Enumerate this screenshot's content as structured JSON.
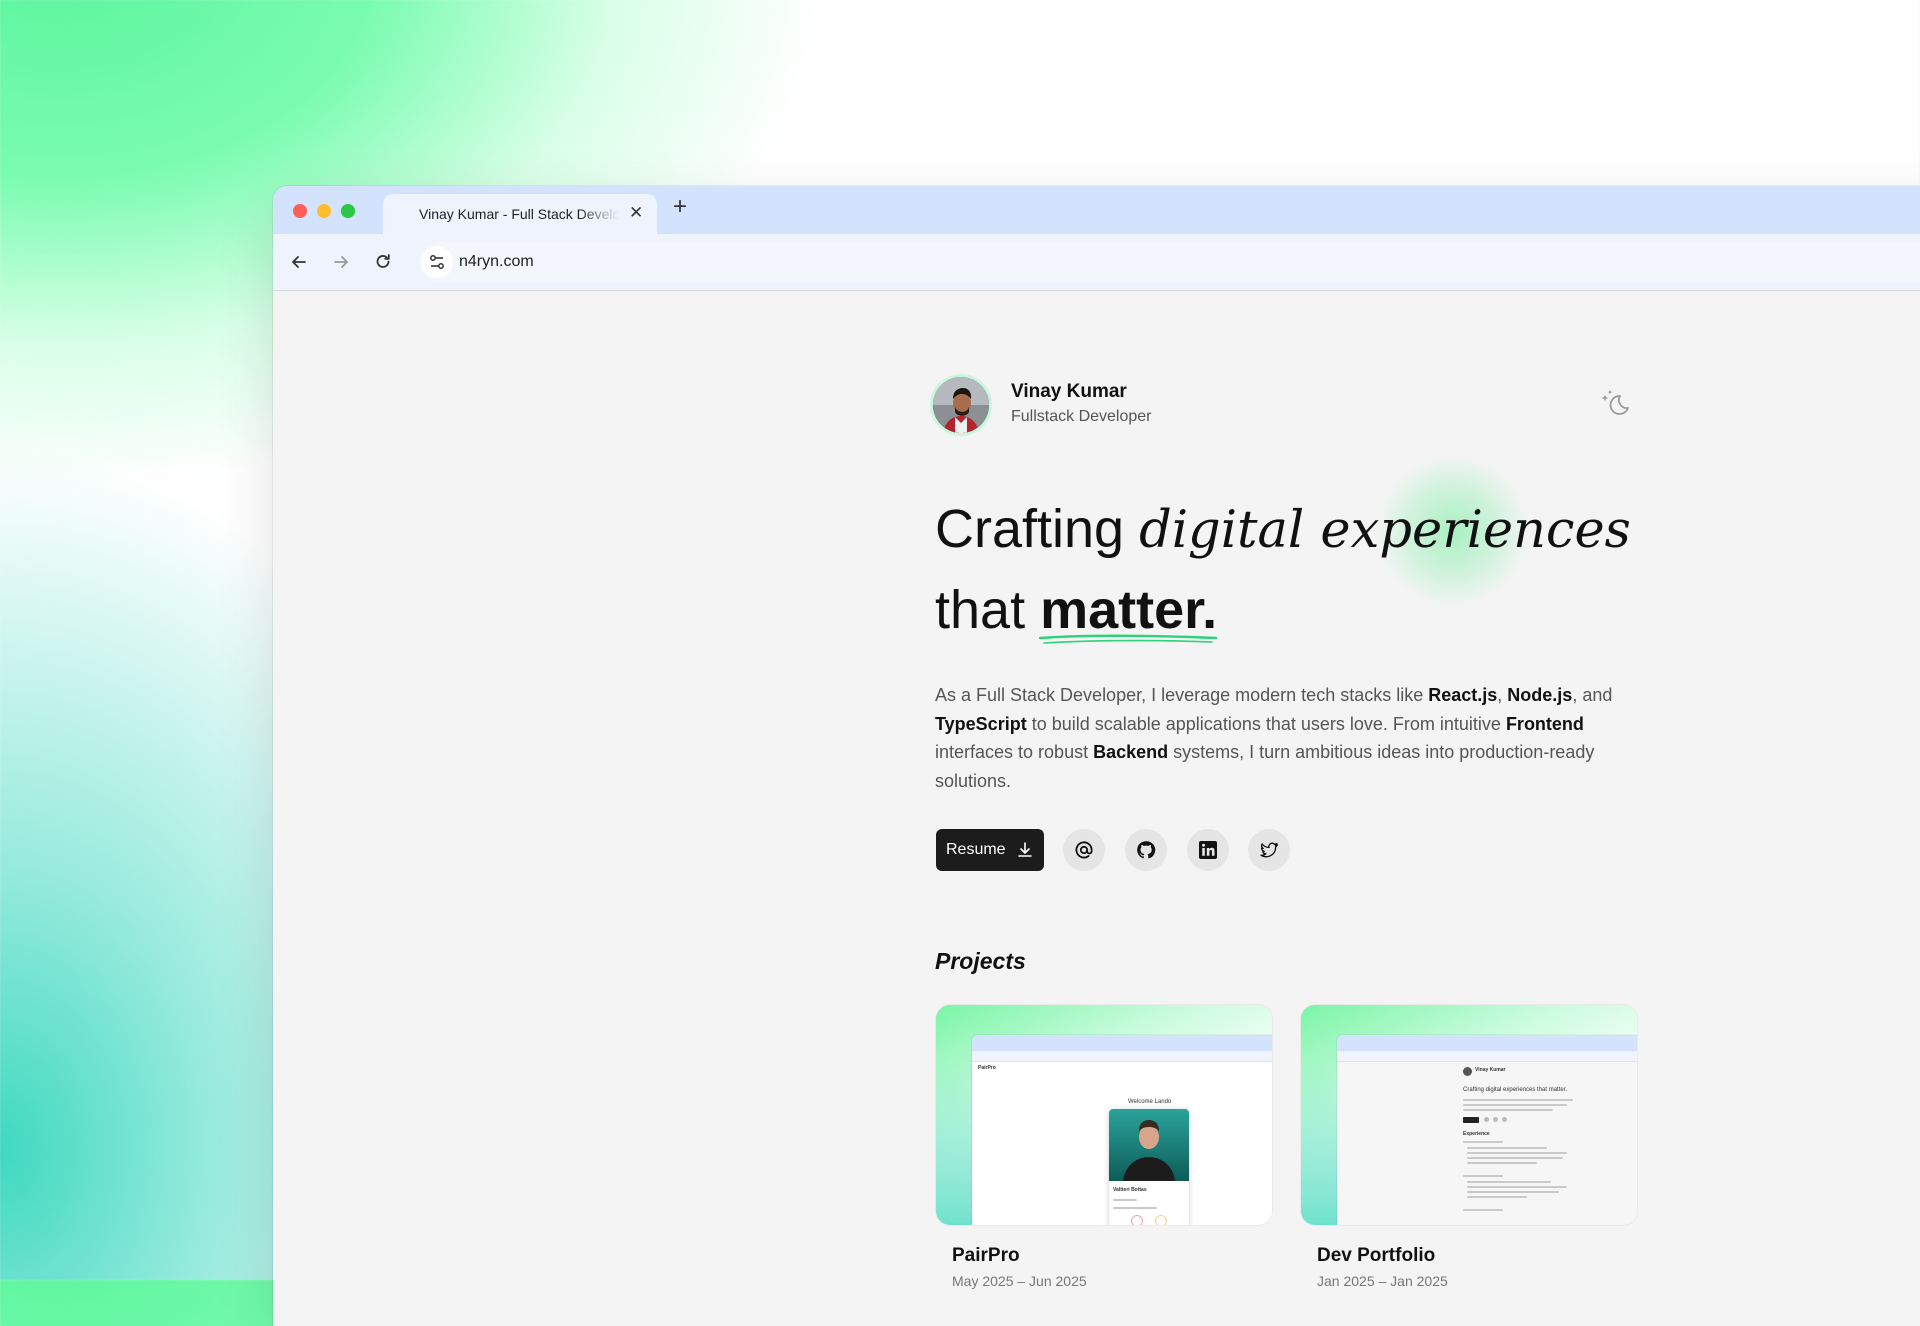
{
  "browser": {
    "tab_title": "Vinay Kumar - Full Stack Developer",
    "tab_close": "✕",
    "new_tab": "+",
    "url": "n4ryn.com",
    "traffic_colors": {
      "close": "#ff5f57",
      "minimize": "#febc2e",
      "maximize": "#28c840"
    }
  },
  "profile": {
    "name": "Vinay Kumar",
    "role": "Fullstack Developer"
  },
  "hero": {
    "line1_plain": "Crafting ",
    "line1_italic": "digital experiences",
    "line2_plain": "that ",
    "line2_bold": "matter."
  },
  "bio": {
    "p1": "As a Full Stack Developer, I leverage modern tech stacks like ",
    "react": "React.js",
    "comma1": ", ",
    "node": "Node.js",
    "p2": ", and ",
    "ts": "TypeScript",
    "p3": " to build scalable applications that users love. From intuitive ",
    "frontend": "Frontend",
    "p4": " interfaces to robust ",
    "backend": "Backend",
    "p5": " systems, I turn ambitious ideas into production-ready solutions."
  },
  "actions": {
    "resume_label": "Resume",
    "socials": [
      "email-icon",
      "github-icon",
      "linkedin-icon",
      "twitter-icon"
    ]
  },
  "projects": {
    "title": "Projects",
    "items": [
      {
        "name": "PairPro",
        "date": "May 2025 – Jun 2025",
        "preview_brand": "PairPro",
        "preview_heading": "Welcome Lando",
        "preview_text": "Valtteri Bottas"
      },
      {
        "name": "Dev Portfolio",
        "date": "Jan 2025 – Jan 2025",
        "preview_name": "Vinay Kumar",
        "preview_heading": "Crafting digital experiences that matter.",
        "preview_section": "Experience"
      }
    ]
  },
  "colors": {
    "accent": "#2fd27a",
    "dark_button": "#1c1c1c"
  }
}
